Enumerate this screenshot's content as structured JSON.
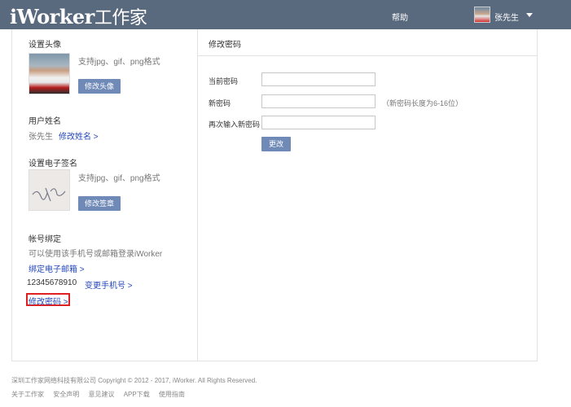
{
  "header": {
    "logo_latin": "iWorker",
    "logo_cn": "工作家",
    "help": "帮助",
    "username": "张先生"
  },
  "left": {
    "avatar_section": {
      "title": "设置头像",
      "hint": "支持jpg、gif、png格式",
      "button": "修改头像"
    },
    "name_section": {
      "title": "用户姓名",
      "value": "张先生",
      "link": "修改姓名 >"
    },
    "signature_section": {
      "title": "设置电子签名",
      "hint": "支持jpg、gif、png格式",
      "button": "修改签章"
    },
    "account_section": {
      "title": "帐号绑定",
      "desc": "可以使用该手机号或邮箱登录iWorker",
      "bind_email": "绑定电子邮箱 >",
      "phone": "12345678910",
      "change_phone": "变更手机号 >",
      "change_password": "修改密码 >"
    }
  },
  "right": {
    "tab_title": "修改密码",
    "form": {
      "current_label": "当前密码",
      "current_value": "",
      "new_label": "新密码",
      "new_value": "",
      "new_hint": "（新密码长度为6-16位）",
      "confirm_label": "再次输入新密码",
      "confirm_value": "",
      "submit": "更改"
    }
  },
  "footer": {
    "copyright": "深圳工作家网络科技有限公司  Copyright © 2012 - 2017, iWorker. All Rights Reserved.",
    "links": [
      "关于工作家",
      "安全声明",
      "意见建议",
      "APP下载",
      "使用指南"
    ]
  },
  "colors": {
    "topbar": "#5a6a7e",
    "button": "#6f8ab7",
    "link": "#2447b8",
    "highlight": "#e02020"
  }
}
